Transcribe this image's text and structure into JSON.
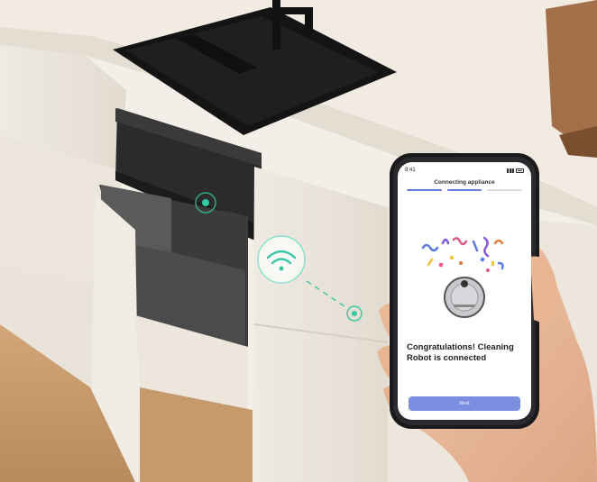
{
  "phone": {
    "status_time": "9:41",
    "title": "Connecting appliance",
    "progress_steps": 3,
    "progress_done": 2,
    "message": "Congratulations! Cleaning Robot is connected",
    "button_label": "Next"
  },
  "colors": {
    "accent": "#7b8ee0",
    "wifi_glow": "#34c8a4",
    "countertop": "#f1ebe2",
    "sink": "#151515"
  }
}
